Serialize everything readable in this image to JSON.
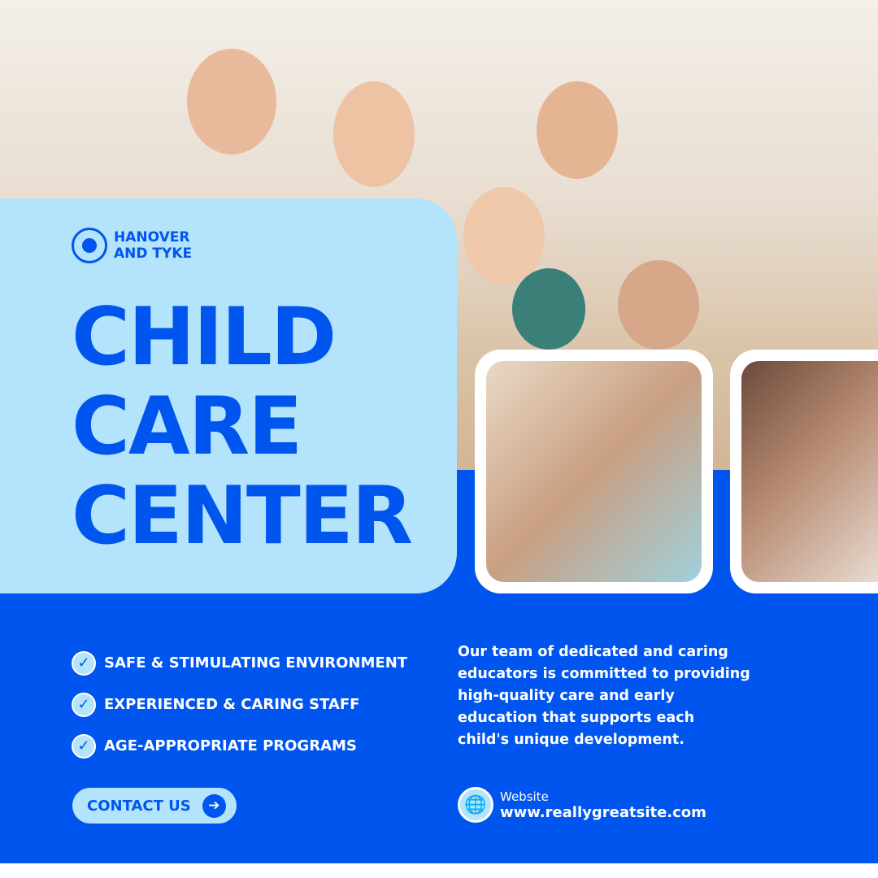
{
  "brand": {
    "name_line1": "HANOVER",
    "name_line2": "AND TYKE"
  },
  "title": {
    "line1": "CHILD",
    "line2": "CARE",
    "line3": "CENTER"
  },
  "features": [
    "SAFE & STIMULATING ENVIRONMENT",
    "EXPERIENCED & CARING STAFF",
    "AGE-APPROPRIATE PROGRAMS"
  ],
  "contact_button": {
    "label": "CONTACT US",
    "icon": "arrow-right-icon"
  },
  "description": "Our team of dedicated and caring educators is committed to providing high-quality care and early education that supports each child's unique development.",
  "website": {
    "label": "Website",
    "url": "www.reallygreatsite.com",
    "icon": "globe-icon"
  },
  "colors": {
    "primary": "#0055ef",
    "light": "#b4e4fb",
    "white": "#ffffff"
  }
}
